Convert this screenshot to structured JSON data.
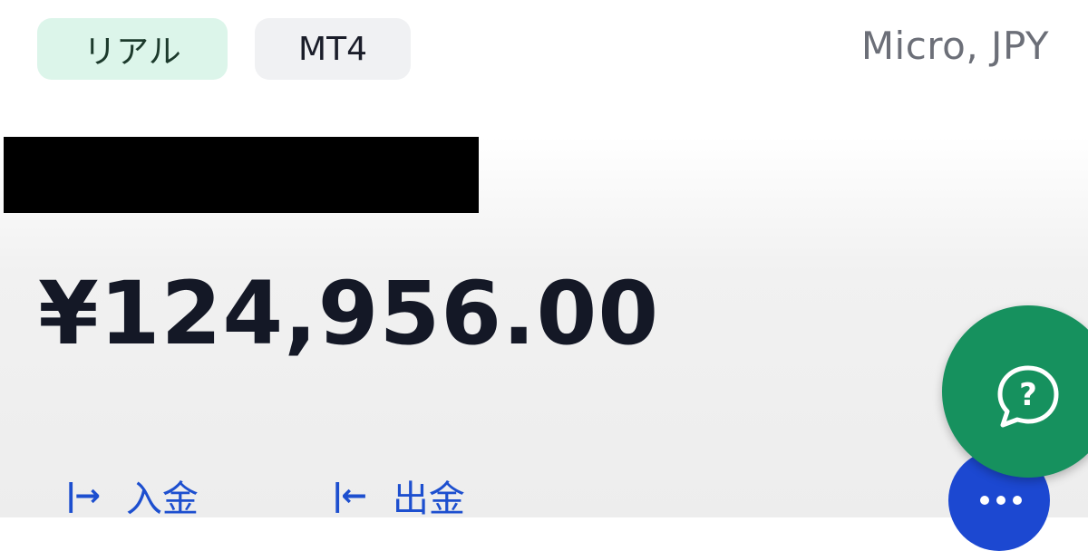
{
  "account": {
    "mode_badge": "リアル",
    "platform_badge": "MT4",
    "account_type": "Micro, JPY",
    "balance": "¥124,956.00"
  },
  "actions": {
    "deposit_label": "入金",
    "deposit_arrow": "|→",
    "withdraw_label": "出金",
    "withdraw_arrow": "|←"
  },
  "fab": {
    "help_icon": "help-chat-icon",
    "more_icon": "more-dots-icon",
    "help_color": "#16915e",
    "more_color": "#1c48d1"
  },
  "colors": {
    "real_badge_bg": "#dcf5ea",
    "platform_badge_bg": "#f0f1f3",
    "action_blue": "#1d4fcf"
  }
}
